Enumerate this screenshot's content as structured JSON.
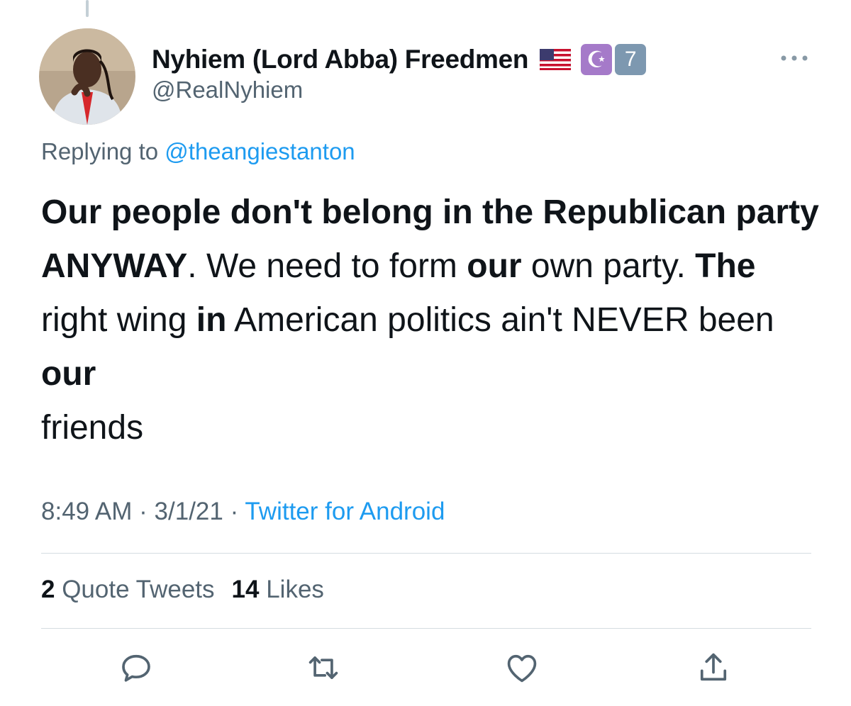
{
  "author": {
    "display_name": "Nyhiem (Lord Abba) Freedmen",
    "handle": "@RealNyhiem",
    "badges": [
      "us-flag",
      "star-and-crescent",
      "keycap-7"
    ],
    "badge_text": {
      "crescent": "☪",
      "keycap": "7"
    }
  },
  "reply": {
    "prefix": "Replying to",
    "mention": "@theangiestanton"
  },
  "tweet": {
    "seg1": "Our people don't belong in the Republican party ANYWAY",
    "seg2": ". We need to form ",
    "seg3": "our",
    "seg4": " own party. ",
    "seg5": "The",
    "seg6": " right wing ",
    "seg7": "in",
    "seg8": " American politics ain't NEVER been ",
    "seg9": "our",
    "seg10": " friends"
  },
  "meta": {
    "time": "8:49 AM",
    "date": "3/1/21",
    "separator": "·",
    "source": "Twitter for Android"
  },
  "stats": {
    "quote_count": "2",
    "quote_label": "Quote Tweets",
    "like_count": "14",
    "like_label": "Likes"
  },
  "actions": [
    "reply-icon",
    "retweet-icon",
    "like-icon",
    "share-icon"
  ],
  "colors": {
    "link": "#1d9bf0",
    "secondary_text": "#536471",
    "primary_text": "#0f1419"
  }
}
